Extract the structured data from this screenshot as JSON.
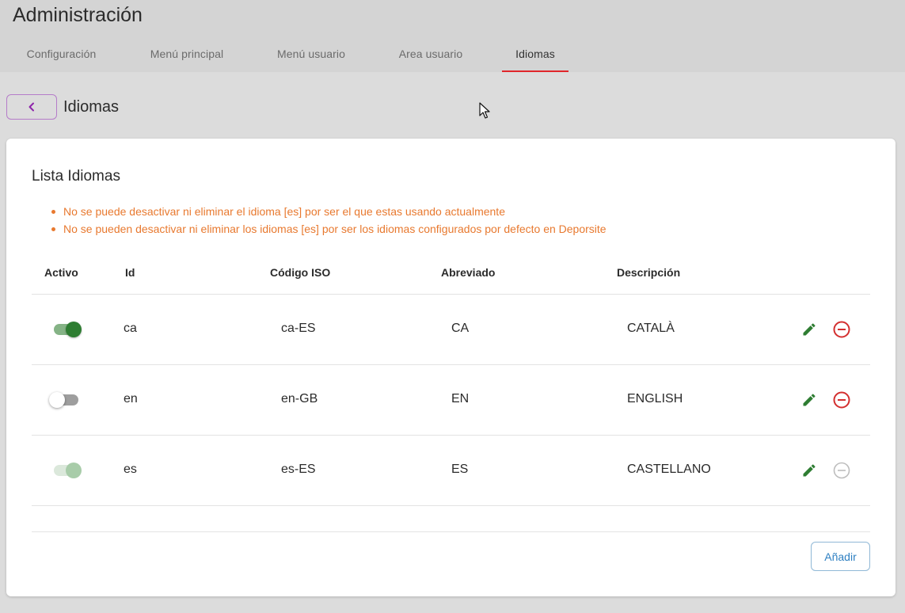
{
  "header": {
    "title": "Administración",
    "tabs": [
      {
        "label": "Configuración"
      },
      {
        "label": "Menú principal"
      },
      {
        "label": "Menú usuario"
      },
      {
        "label": "Area usuario"
      },
      {
        "label": "Idiomas"
      }
    ],
    "active_tab": "Idiomas"
  },
  "section": {
    "title": "Idiomas",
    "back_icon": "chevron-left-icon"
  },
  "card": {
    "title": "Lista Idiomas",
    "warnings": [
      "No se puede desactivar ni eliminar el idioma [es] por ser el que estas usando actualmente",
      "No se pueden desactivar ni eliminar los idiomas [es] por ser los idiomas configurados por defecto en Deporsite"
    ],
    "columns": {
      "active": "Activo",
      "id": "Id",
      "iso": "Código ISO",
      "short": "Abreviado",
      "description": "Descripción"
    },
    "rows": [
      {
        "active": true,
        "disabled": false,
        "id": "ca",
        "iso": "ca-ES",
        "short": "CA",
        "description": "CATALÀ",
        "delete_enabled": true
      },
      {
        "active": false,
        "disabled": false,
        "id": "en",
        "iso": "en-GB",
        "short": "EN",
        "description": "ENGLISH",
        "delete_enabled": true
      },
      {
        "active": true,
        "disabled": true,
        "id": "es",
        "iso": "es-ES",
        "short": "ES",
        "description": "CASTELLANO",
        "delete_enabled": false
      }
    ],
    "add_label": "Añadir"
  },
  "colors": {
    "accent_tab": "#e0262b",
    "warning": "#e8792f",
    "toggle_on": "#2e7d32",
    "edit_icon": "#2e7d32",
    "delete_icon": "#d32f2f",
    "delete_icon_disabled": "#bdbdbd",
    "add_button": "#2f80c2"
  }
}
